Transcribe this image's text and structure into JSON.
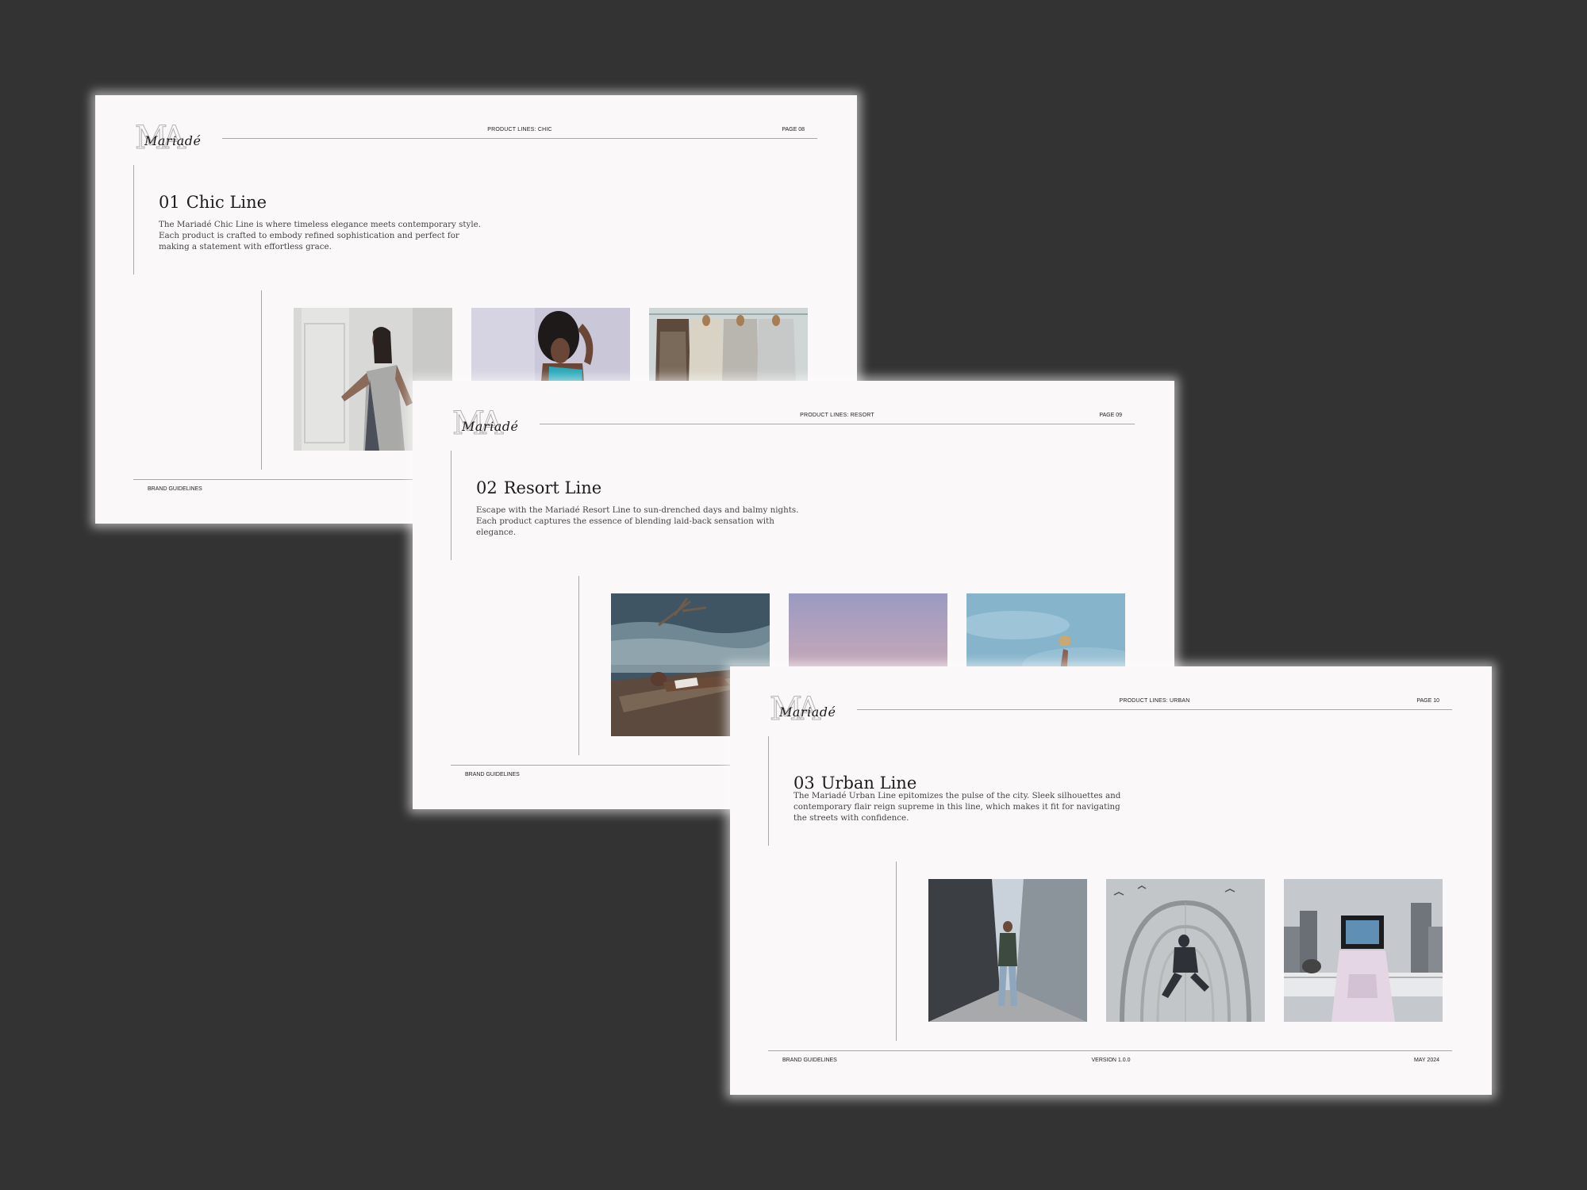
{
  "logo": {
    "monogram": "MA",
    "script": "Mariadé"
  },
  "slides": [
    {
      "header_title": "PRODUCT LINES: CHIC",
      "page": "PAGE 08",
      "number": "01",
      "title": "Chic Line",
      "description": "The Mariadé Chic Line is where timeless elegance meets contemporary style. Each product is crafted to embody refined sophistication and perfect for making a statement with effortless grace.",
      "footer_left": "BRAND GUIDELINES"
    },
    {
      "header_title": "PRODUCT LINES: RESORT",
      "page": "PAGE 09",
      "number": "02",
      "title": "Resort Line",
      "description": "Escape with the Mariadé Resort Line to sun-drenched days and balmy nights. Each product captures the essence of blending laid-back sensation with elegance.",
      "footer_left": "BRAND GUIDELINES"
    },
    {
      "header_title": "PRODUCT LINES: URBAN",
      "page": "PAGE 10",
      "number": "03",
      "title": "Urban Line",
      "description": "The Mariadé Urban Line epitomizes the pulse of the city. Sleek silhouettes and contemporary flair reign supreme in this line, which makes it fit for navigating the streets with confidence.",
      "footer_left": "BRAND GUIDELINES",
      "footer_center": "VERSION 1.0.0",
      "footer_right": "MAY 2024"
    }
  ],
  "colors": {
    "background": "#333333",
    "slide": "#faf8f9",
    "rule": "#a8a8a8",
    "text": "#1d1d1d"
  }
}
